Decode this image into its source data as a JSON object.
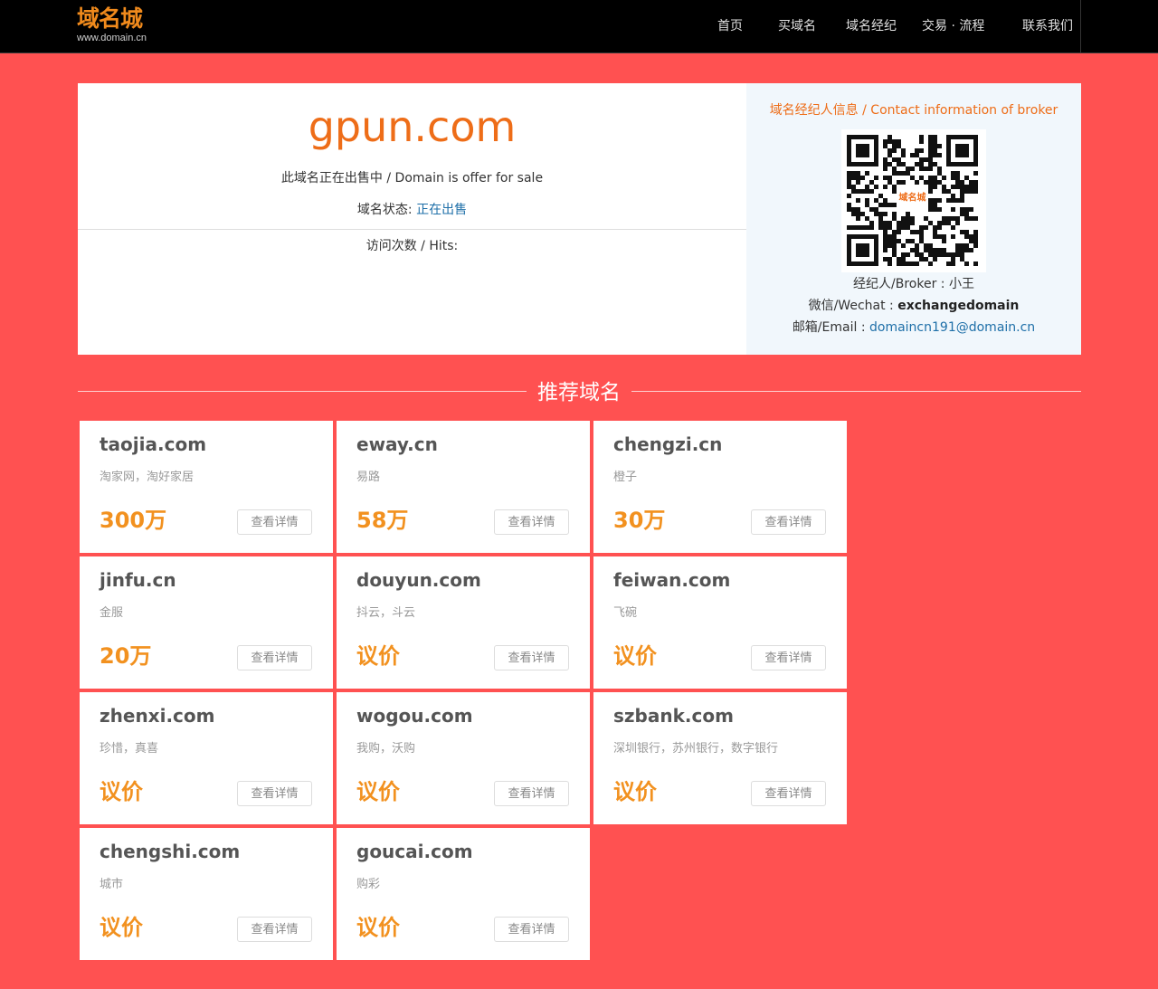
{
  "header": {
    "logo_text": "域名城",
    "logo_url": "www.domain.cn",
    "nav": [
      "首页",
      "买域名",
      "域名经纪",
      "交易 · 流程",
      "联系我们"
    ]
  },
  "domain": {
    "name": "gpun.com",
    "sale_text": "此域名正在出售中 / Domain is offer for sale",
    "status_label": "域名状态:",
    "status_value": "正在出售",
    "hits_text": "访问次数 / Hits:"
  },
  "broker": {
    "heading": "域名经纪人信息 / Contact information of broker",
    "name_label": "经纪人/Broker :",
    "name_value": "小王",
    "wechat_label": "微信/Wechat :",
    "wechat_value": "exchangedomain",
    "email_label": "邮箱/Email :",
    "email_value": "domaincn191@domain.cn",
    "qr_badge": "域名城"
  },
  "recommend": {
    "title": "推荐域名",
    "button_label": "查看详情",
    "items": [
      {
        "name": "taojia.com",
        "desc": "淘家网，淘好家居",
        "price": "300万"
      },
      {
        "name": "eway.cn",
        "desc": "易路",
        "price": "58万"
      },
      {
        "name": "chengzi.cn",
        "desc": "橙子",
        "price": "30万"
      },
      {
        "name": "jinfu.cn",
        "desc": "金服",
        "price": "20万"
      },
      {
        "name": "douyun.com",
        "desc": "抖云，斗云",
        "price": "议价"
      },
      {
        "name": "feiwan.com",
        "desc": "飞碗",
        "price": "议价"
      },
      {
        "name": "zhenxi.com",
        "desc": "珍惜，真喜",
        "price": "议价"
      },
      {
        "name": "wogou.com",
        "desc": "我购，沃购",
        "price": "议价"
      },
      {
        "name": "szbank.com",
        "desc": "深圳银行，苏州银行，数字银行",
        "price": "议价"
      },
      {
        "name": "chengshi.com",
        "desc": "城市",
        "price": "议价"
      },
      {
        "name": "goucai.com",
        "desc": "购彩",
        "price": "议价"
      }
    ]
  }
}
